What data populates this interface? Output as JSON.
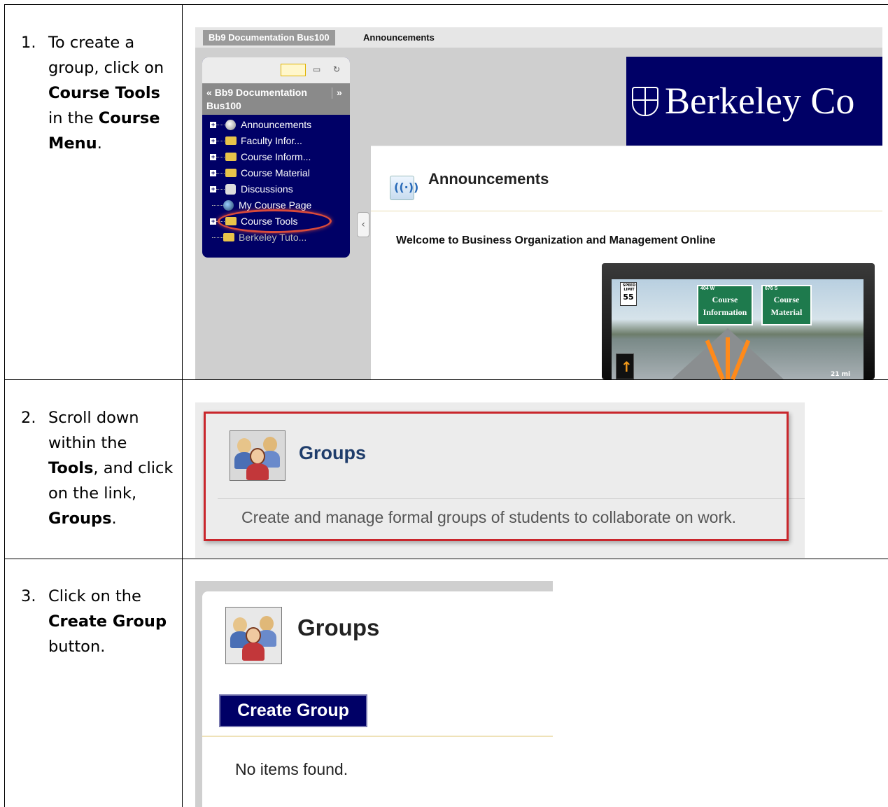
{
  "steps": [
    {
      "number": "1.",
      "parts": [
        "To create a group, click on ",
        "Course Tools",
        " in the ",
        "Course Menu",
        "."
      ]
    },
    {
      "number": "2.",
      "parts": [
        "Scroll down within the ",
        "Tools",
        ", and click on the link, ",
        "Groups",
        "."
      ]
    },
    {
      "number": "3.",
      "parts": [
        "Click on the ",
        "Create Group",
        " button."
      ]
    }
  ],
  "screenshot1": {
    "breadcrumb": [
      "Bb9 Documentation Bus100",
      "Announcements"
    ],
    "course_menu": {
      "title_line1": "Bb9 Documentation",
      "title_line2": "Bus100",
      "expand_icon": "chevron-double-up-icon",
      "collapse_icon": "chevron-double-right-icon",
      "items": [
        {
          "label": "Announcements",
          "icon": "globe-icon",
          "expandable": true
        },
        {
          "label": "Faculty Infor...",
          "icon": "folder-icon",
          "expandable": true
        },
        {
          "label": "Course Inform...",
          "icon": "folder-icon",
          "expandable": true
        },
        {
          "label": "Course Material",
          "icon": "folder-icon",
          "expandable": true
        },
        {
          "label": "Discussions",
          "icon": "discussion-icon",
          "expandable": true
        },
        {
          "label": "My Course Page",
          "icon": "globe-icon",
          "expandable": false
        },
        {
          "label": "Course Tools",
          "icon": "folder-icon",
          "expandable": true
        },
        {
          "label": "Berkeley Tuto...",
          "icon": "folder-icon",
          "expandable": false
        }
      ],
      "highlighted_item": "Course Tools"
    },
    "banner_text": "Berkeley Co",
    "content_title": "Announcements",
    "welcome_text": "Welcome to Business Organization and Management Online",
    "video": {
      "speed_limit_label": "SPEED LIMIT",
      "speed_limit": "55",
      "signs": [
        {
          "route": "404 W",
          "line1": "Course",
          "line2": "Information"
        },
        {
          "route": "676 S",
          "line1": "Course",
          "line2": "Material"
        }
      ],
      "distance": "21 mi"
    }
  },
  "screenshot2": {
    "title": "Groups",
    "description": "Create and manage formal groups of students to collaborate on work."
  },
  "screenshot3": {
    "title": "Groups",
    "button_label": "Create Group",
    "empty_message": "No items found."
  },
  "colors": {
    "bb_navy": "#000066",
    "highlight_red": "#c9262c",
    "link_blue": "#1f3d6b"
  }
}
